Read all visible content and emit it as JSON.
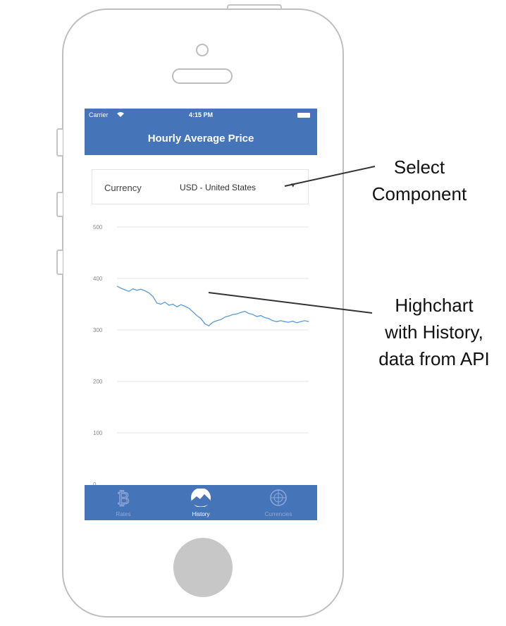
{
  "status_bar": {
    "carrier": "Carrier",
    "time": "4:15 PM"
  },
  "nav": {
    "title": "Hourly Average Price"
  },
  "currency_select": {
    "label": "Currency",
    "value": "USD - United States"
  },
  "chart_data": {
    "type": "line",
    "title": "",
    "xlabel": "",
    "ylabel": "",
    "ylim": [
      0,
      500
    ],
    "y_ticks": [
      "500",
      "400",
      "300",
      "200",
      "100",
      "0"
    ],
    "grid": true,
    "series": [
      {
        "color": "#5b9bd5",
        "values": [
          385,
          381,
          378,
          375,
          380,
          377,
          379,
          376,
          372,
          365,
          352,
          350,
          354,
          348,
          350,
          345,
          349,
          346,
          342,
          335,
          328,
          322,
          312,
          308,
          315,
          318,
          320,
          325,
          327,
          330,
          331,
          334,
          336,
          332,
          330,
          326,
          328,
          324,
          322,
          318,
          316,
          318,
          316,
          315,
          317,
          314,
          316,
          318,
          316
        ]
      }
    ]
  },
  "tabs": [
    {
      "label": "Rates",
      "icon": "bitcoin-icon",
      "active": false
    },
    {
      "label": "History",
      "icon": "mountain-chart-icon",
      "active": true
    },
    {
      "label": "Currencies",
      "icon": "globe-icon",
      "active": false
    }
  ],
  "annotations": {
    "select": [
      "Select",
      "Component"
    ],
    "chart": [
      "Highchart",
      "with History,",
      "data from API"
    ]
  },
  "colors": {
    "bar": "#4674b9",
    "line": "#5b9bd5",
    "grid": "#e6e6e6"
  }
}
